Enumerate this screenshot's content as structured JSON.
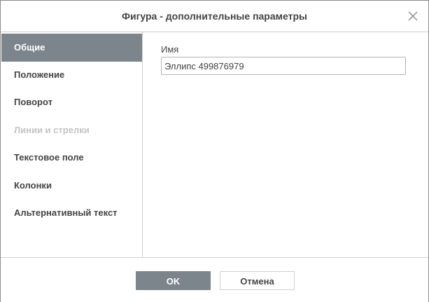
{
  "dialog": {
    "title": "Фигура - дополнительные параметры",
    "close_icon": "close-icon"
  },
  "sidebar": {
    "items": [
      {
        "label": "Общие",
        "state": "active"
      },
      {
        "label": "Положение",
        "state": "normal"
      },
      {
        "label": "Поворот",
        "state": "normal"
      },
      {
        "label": "Линии и стрелки",
        "state": "disabled"
      },
      {
        "label": "Текстовое поле",
        "state": "normal"
      },
      {
        "label": "Колонки",
        "state": "normal"
      },
      {
        "label": "Альтернативный текст",
        "state": "normal"
      }
    ]
  },
  "general": {
    "name_label": "Имя",
    "name_value": "Эллипс 499876979"
  },
  "footer": {
    "ok_label": "OK",
    "cancel_label": "Отмена"
  },
  "colors": {
    "accent": "#7d858c",
    "text": "#444444",
    "disabled_text": "#c4c4c4",
    "border": "#cfcfcf"
  }
}
